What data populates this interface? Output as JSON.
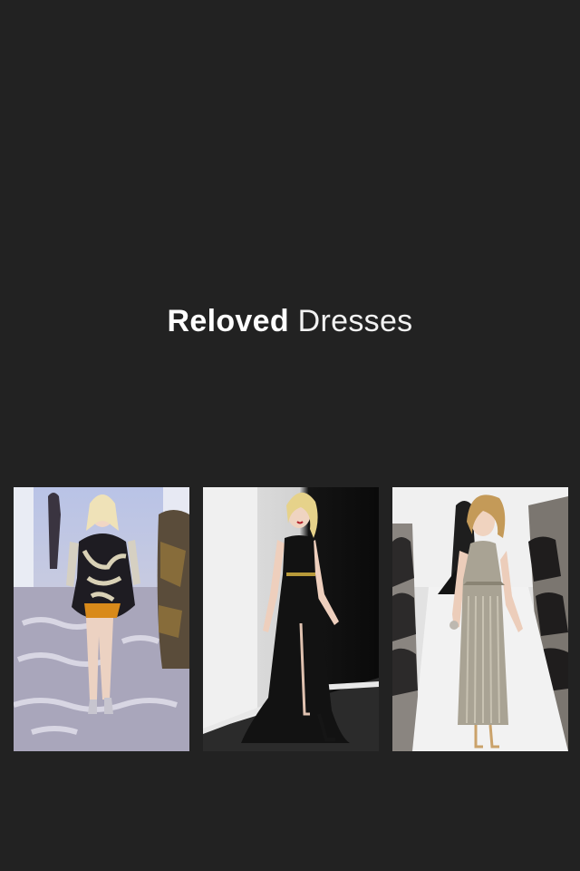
{
  "header": {
    "title_bold": "Reloved",
    "title_light": "Dresses"
  },
  "gallery": {
    "items": [
      {
        "icon": "runway-photo-floral-dress"
      },
      {
        "icon": "runway-photo-black-gown"
      },
      {
        "icon": "runway-photo-silver-fringe-dress"
      }
    ]
  },
  "colors": {
    "background": "#222222",
    "title": "#ffffff"
  }
}
